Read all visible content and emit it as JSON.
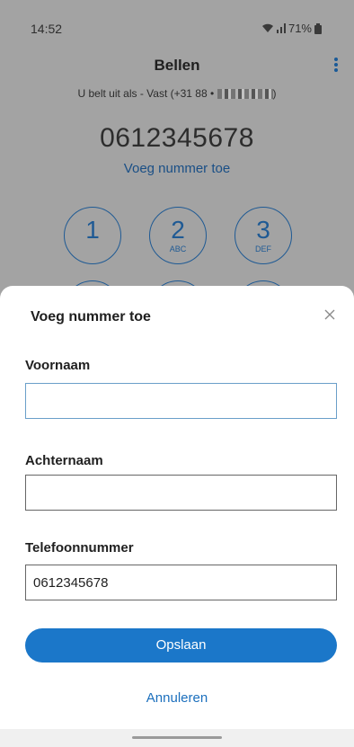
{
  "status": {
    "time": "14:52",
    "battery": "71%"
  },
  "app": {
    "title": "Bellen",
    "caller_line": "U belt uit als - Vast (+31 88 •",
    "caller_line_end": ")",
    "dialed_number": "0612345678",
    "add_number_link": "Voeg nummer toe"
  },
  "keypad": [
    {
      "digit": "1",
      "letters": ""
    },
    {
      "digit": "2",
      "letters": "ABC"
    },
    {
      "digit": "3",
      "letters": "DEF"
    }
  ],
  "sheet": {
    "title": "Voeg nummer toe",
    "first_name_label": "Voornaam",
    "first_name_value": "",
    "last_name_label": "Achternaam",
    "last_name_value": "",
    "phone_label": "Telefoonnummer",
    "phone_value": "0612345678",
    "save_label": "Opslaan",
    "cancel_label": "Annuleren"
  },
  "colors": {
    "accent": "#1b77c9",
    "link": "#1b6fbd",
    "overlay_bg": "#a3a3a3"
  }
}
